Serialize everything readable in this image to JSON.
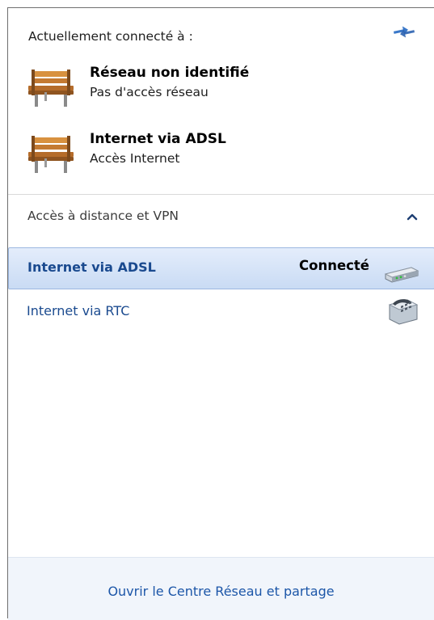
{
  "header": {
    "label": "Actuellement connecté à :",
    "refresh_icon": "refresh-arrows-icon"
  },
  "connected": [
    {
      "name": "Réseau non identifié",
      "status": "Pas d'accès réseau",
      "icon": "network-bench-icon"
    },
    {
      "name": "Internet via ADSL",
      "status": "Accès Internet",
      "icon": "network-bench-icon"
    }
  ],
  "dialup_section": {
    "label": "Accès à distance et VPN",
    "collapse_icon": "chevron-up-icon",
    "items": [
      {
        "name": "Internet via ADSL",
        "state": "Connecté",
        "icon": "modem-icon",
        "selected": true
      },
      {
        "name": "Internet via RTC",
        "state": "",
        "icon": "phone-modem-icon",
        "selected": false
      }
    ]
  },
  "footer": {
    "link": "Ouvrir le Centre Réseau et partage"
  },
  "colors": {
    "link": "#1c56a8",
    "selection_bg": "#c9dbf4",
    "selection_border": "#9cb8e1",
    "footer_bg": "#f1f5fb",
    "bench_wood": "#c47a32"
  }
}
